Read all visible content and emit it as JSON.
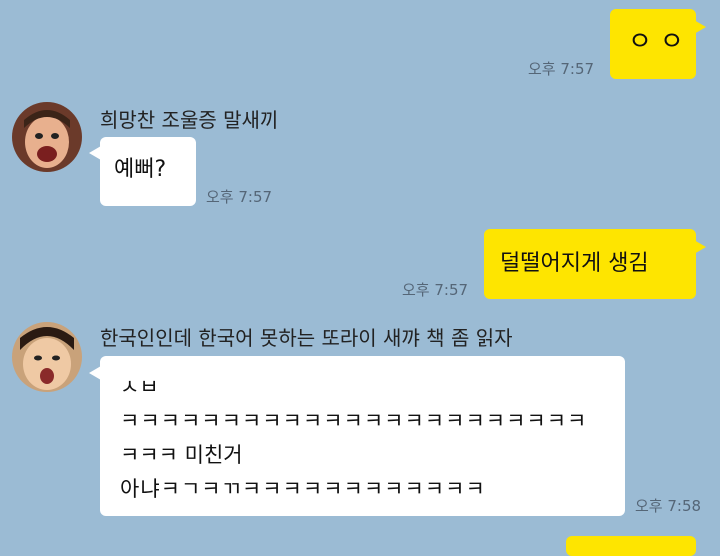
{
  "colors": {
    "background": "#9bbbd4",
    "my_bubble": "#fee500",
    "their_bubble": "#ffffff"
  },
  "messages": [
    {
      "sender": "me",
      "text": "ㅇㅇ",
      "time": "오후 7:57"
    },
    {
      "sender": "희망찬 조울증 말새끼",
      "avatar": "avatar-face",
      "text": "예뻐?",
      "time": "오후 7:57"
    },
    {
      "sender": "me",
      "text": "덜떨어지게 생김",
      "time": "오후 7:57"
    },
    {
      "sender": "한국인인데 한국어 못하는 또라이 새꺄 책 좀 읽자",
      "avatar": "avatar-face",
      "lines": [
        "ㅅㅂ",
        "ㅋㅋㅋㅋㅋㅋㅋㅋㅋㅋㅋㅋㅋㅋㅋㅋㅋㅋㅋㅋㅋㅋㅋ",
        "ㅋㅋㅋ 미친거",
        "아냐ㅋㄱㅋㄲㅋㅋㅋㅋㅋㅋㅋㅋㅋㅋㅋㅋ"
      ],
      "time": "오후 7:58"
    }
  ]
}
